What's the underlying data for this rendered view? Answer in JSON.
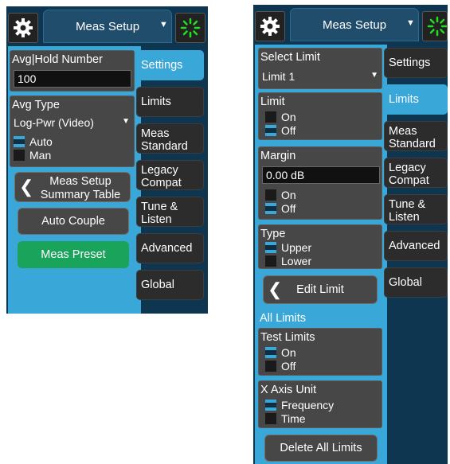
{
  "title": "Meas Setup",
  "tabs": [
    {
      "id": "settings",
      "label": "Settings"
    },
    {
      "id": "limits",
      "label": "Limits"
    },
    {
      "id": "meas_standard",
      "label": "Meas Standard",
      "lines": [
        "Meas",
        "Standard"
      ]
    },
    {
      "id": "legacy_compat",
      "label": "Legacy Compat",
      "lines": [
        "Legacy",
        "Compat"
      ]
    },
    {
      "id": "tune_listen",
      "label": "Tune & Listen",
      "lines": [
        "Tune &",
        "Listen"
      ]
    },
    {
      "id": "advanced",
      "label": "Advanced"
    },
    {
      "id": "global",
      "label": "Global"
    }
  ],
  "left_panel": {
    "active_tab": "Settings",
    "avg_hold": {
      "label": "Avg|Hold Number",
      "value": "100"
    },
    "avg_type": {
      "label": "Avg Type",
      "value": "Log-Pwr (Video)",
      "options": [
        "Auto",
        "Man"
      ],
      "selected": "Auto"
    },
    "summary_button": {
      "line1": "Meas Setup",
      "line2": "Summary Table"
    },
    "auto_couple": "Auto Couple",
    "meas_preset": "Meas Preset"
  },
  "right_panel": {
    "active_tab": "Limits",
    "select_limit": {
      "label": "Select Limit",
      "value": "Limit 1"
    },
    "limit": {
      "label": "Limit",
      "options": [
        "On",
        "Off"
      ],
      "selected": "Off"
    },
    "margin": {
      "label": "Margin",
      "value": "0.00 dB",
      "options": [
        "On",
        "Off"
      ],
      "selected": "Off"
    },
    "type": {
      "label": "Type",
      "options": [
        "Upper",
        "Lower"
      ],
      "selected": "Upper"
    },
    "edit_limit": "Edit Limit",
    "all_limits_header": "All Limits",
    "test_limits": {
      "label": "Test Limits",
      "options": [
        "On",
        "Off"
      ],
      "selected": "On"
    },
    "x_axis_unit": {
      "label": "X Axis Unit",
      "options": [
        "Frequency",
        "Time"
      ],
      "selected": "Frequency"
    },
    "delete_all": "Delete All Limits"
  },
  "colors": {
    "accent": "#3aa7d9",
    "panel": "#0f3650",
    "tab": "#2c2c2c",
    "green": "#1aa35a"
  },
  "icons": {
    "settings": "gear-icon",
    "busy": "spinner-icon",
    "dropdown": "triangle-down-icon",
    "back": "chevron-left-icon"
  }
}
